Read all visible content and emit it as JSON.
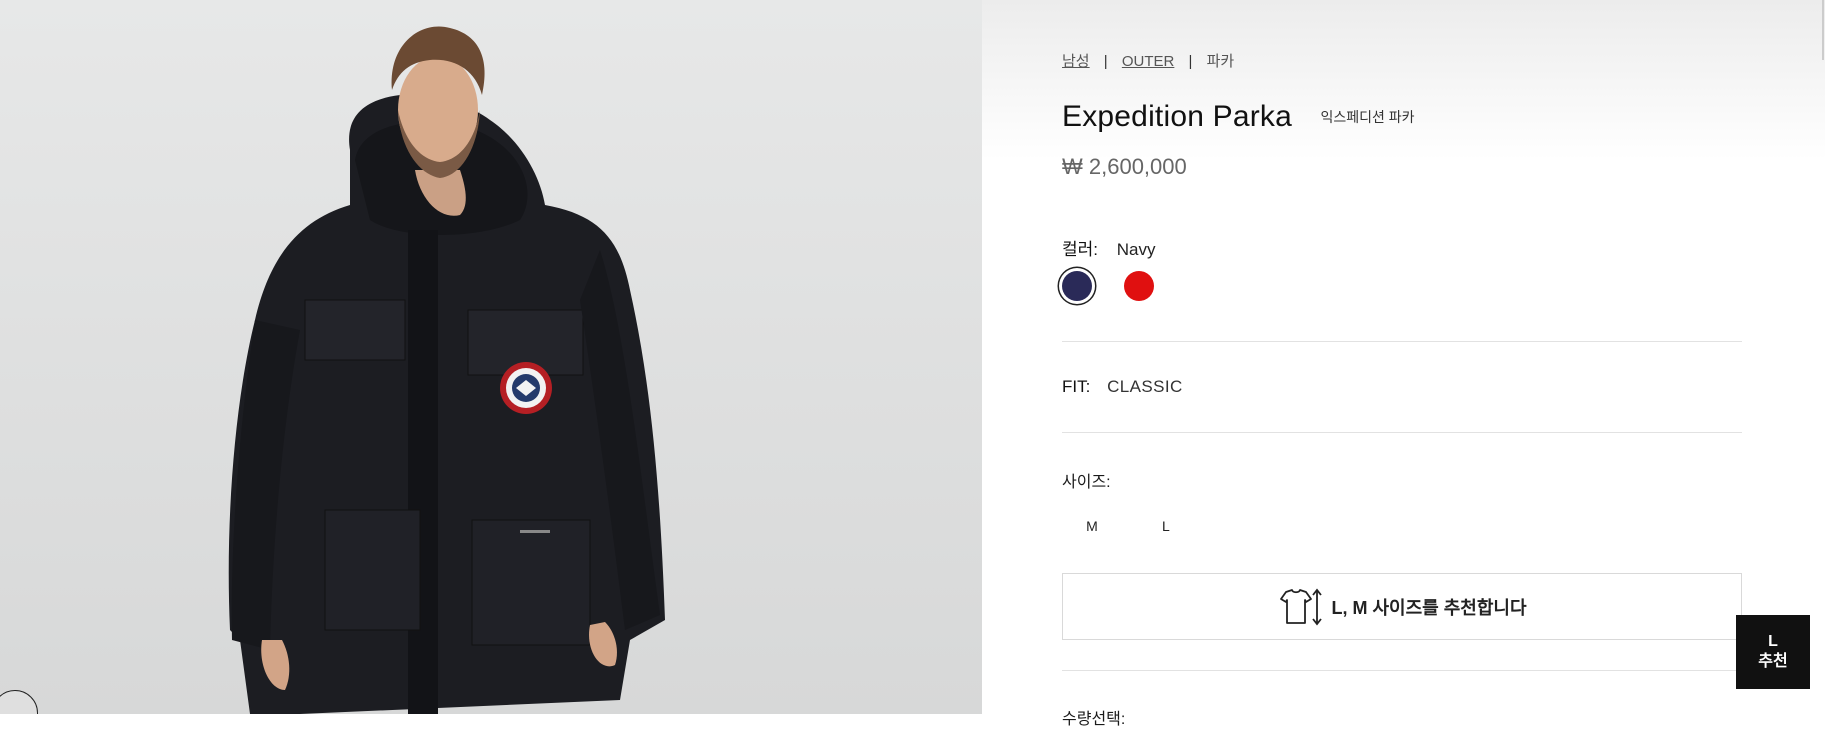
{
  "breadcrumb": {
    "items": [
      "남성",
      "OUTER",
      "파카"
    ],
    "separator": "|"
  },
  "product": {
    "name": "Expedition Parka",
    "name_local": "익스페디션 파카",
    "price": "₩ 2,600,000"
  },
  "color": {
    "label": "컬러:",
    "selected": "Navy",
    "swatches": [
      {
        "name": "Navy",
        "hex": "#2a2a58"
      },
      {
        "name": "Red",
        "hex": "#e01010"
      }
    ]
  },
  "fit": {
    "label": "FIT:",
    "value": "CLASSIC"
  },
  "size": {
    "label": "사이즈:",
    "options": [
      "M",
      "L"
    ],
    "recommend_text": "L, M 사이즈를 추천합니다"
  },
  "quantity": {
    "label": "수량선택:"
  },
  "badge": {
    "line1": "L",
    "line2": "추천"
  },
  "icons": {
    "fit_icon": "tshirt-size-icon"
  }
}
